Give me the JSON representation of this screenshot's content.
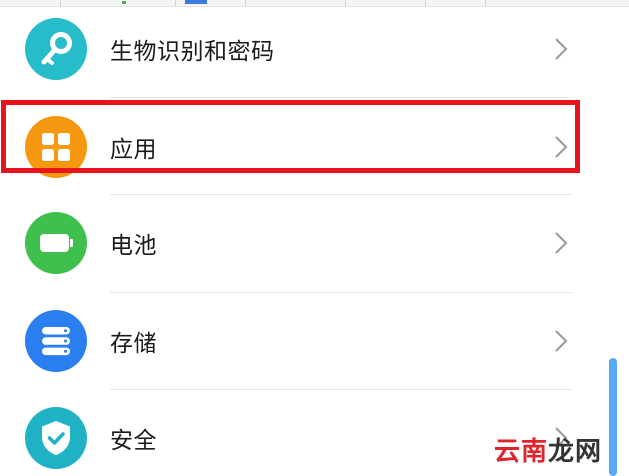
{
  "settings": {
    "items": [
      {
        "label": "生物识别和密码",
        "icon": "key-icon",
        "color": "#26bcc9"
      },
      {
        "label": "应用",
        "icon": "apps-grid-icon",
        "color": "#f6980f"
      },
      {
        "label": "电池",
        "icon": "battery-icon",
        "color": "#3fbf4e"
      },
      {
        "label": "存储",
        "icon": "storage-icon",
        "color": "#2a7ef0"
      },
      {
        "label": "安全",
        "icon": "shield-check-icon",
        "color": "#1fb1c4"
      }
    ],
    "chevron_icon": "chevron-right-icon",
    "highlight_color": "#e8141b",
    "scrollbar_color": "#5aa9f5"
  },
  "watermark": {
    "chars": [
      "云",
      "南",
      "龙",
      "网"
    ]
  }
}
